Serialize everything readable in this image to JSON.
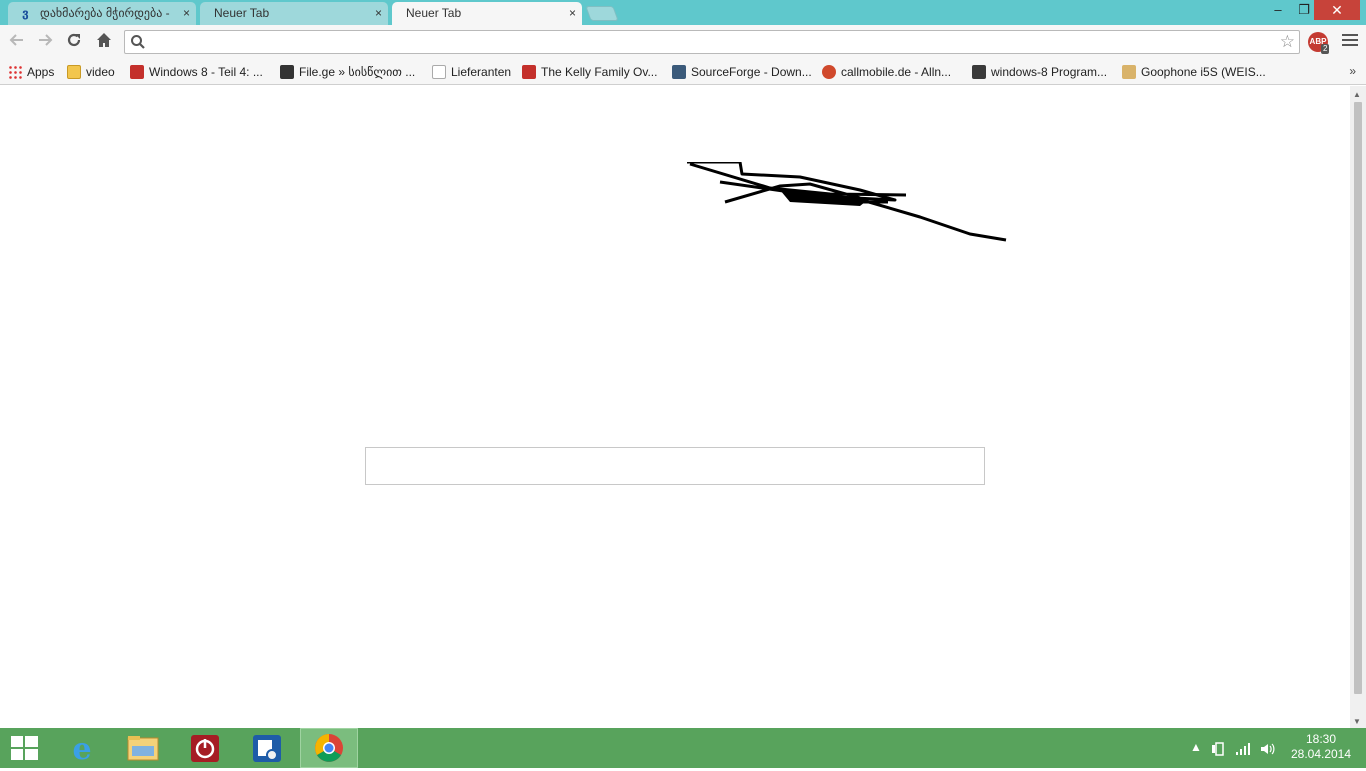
{
  "tabs": [
    {
      "favicon": "ვ",
      "title": "დახმარება მჭირდება -",
      "close": "×",
      "active": false
    },
    {
      "title": "Neuer Tab",
      "close": "×",
      "active": false
    },
    {
      "title": "Neuer Tab",
      "close": "×",
      "active": true
    }
  ],
  "window_controls": {
    "minimize": "–",
    "restore": "❐",
    "close": "✕"
  },
  "toolbar": {
    "back_icon": "arrow-left-icon",
    "forward_icon": "arrow-right-icon",
    "reload_icon": "reload-icon",
    "home_icon": "home-icon",
    "omnibox_value": "",
    "star_icon": "star-icon",
    "abp_label": "ABP",
    "abp_count": "2",
    "menu_icon": "hamburger-menu-icon"
  },
  "bookmarks": [
    {
      "label": "Apps",
      "icon": "apps-grid-icon"
    },
    {
      "label": "video",
      "icon": "folder-icon"
    },
    {
      "label": "Windows 8 - Teil 4: ...",
      "icon": "youtube-icon"
    },
    {
      "label": "File.ge » სისწლით ...",
      "icon": "file-ge-icon"
    },
    {
      "label": "Lieferanten",
      "icon": "page-icon"
    },
    {
      "label": "The Kelly Family Ov...",
      "icon": "youtube-icon"
    },
    {
      "label": "SourceForge - Down...",
      "icon": "sourceforge-icon"
    },
    {
      "label": "callmobile.de - Alln...",
      "icon": "callmobile-icon"
    },
    {
      "label": "windows-8 Program...",
      "icon": "star-site-icon"
    },
    {
      "label": "Goophone i5S (WEIS...",
      "icon": "goophone-icon"
    }
  ],
  "bookmarks_overflow": "»",
  "ntp": {
    "search_value": ""
  },
  "taskbar": {
    "items": [
      "windows-start-icon",
      "internet-explorer-icon",
      "file-explorer-icon",
      "power-app-icon",
      "settings-app-icon",
      "chrome-icon"
    ],
    "clock_time": "18:30",
    "clock_date": "28.04.2014"
  },
  "colors": {
    "titlebar": "#5fc8cc",
    "taskbar": "#58a35c",
    "close_button": "#c7433a"
  }
}
